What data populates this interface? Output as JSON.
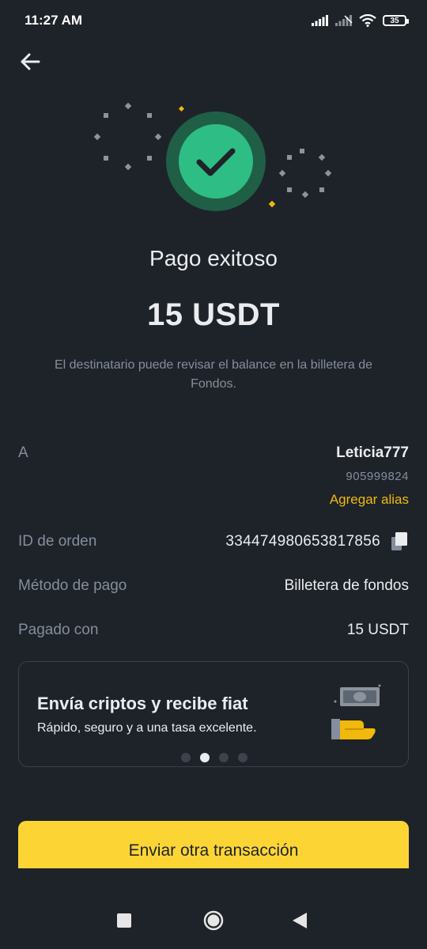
{
  "status_bar": {
    "time": "11:27 AM",
    "battery": "35"
  },
  "header": {
    "back_icon": "arrow-left-icon"
  },
  "hero": {
    "icon": "check-circle-icon",
    "accent_color": "#2ebd85",
    "ring_color": "#1f5f45"
  },
  "result": {
    "title": "Pago exitoso",
    "amount": "15 USDT",
    "message": "El destinatario puede revisar el balance en la billetera de Fondos."
  },
  "details": {
    "to_label": "A",
    "recipient_name": "Leticia777",
    "recipient_id": "905999824",
    "add_alias": "Agregar alias",
    "order_id_label": "ID de orden",
    "order_id": "334474980653817856",
    "copy_icon": "copy-icon",
    "payment_method_label": "Método de pago",
    "payment_method": "Billetera de fondos",
    "paid_with_label": "Pagado con",
    "paid_with": "15 USDT"
  },
  "promo": {
    "title": "Envía criptos y recibe fiat",
    "subtitle": "Rápido, seguro y a una tasa excelente.",
    "illustration": "cash-hand-icon",
    "slide_count": 4,
    "active_slide": 2
  },
  "cta": {
    "label": "Enviar otra transacción",
    "color": "#fcd535"
  },
  "nav_bar": {
    "recent_icon": "square-icon",
    "home_icon": "circle-icon",
    "back_icon": "triangle-back-icon"
  }
}
